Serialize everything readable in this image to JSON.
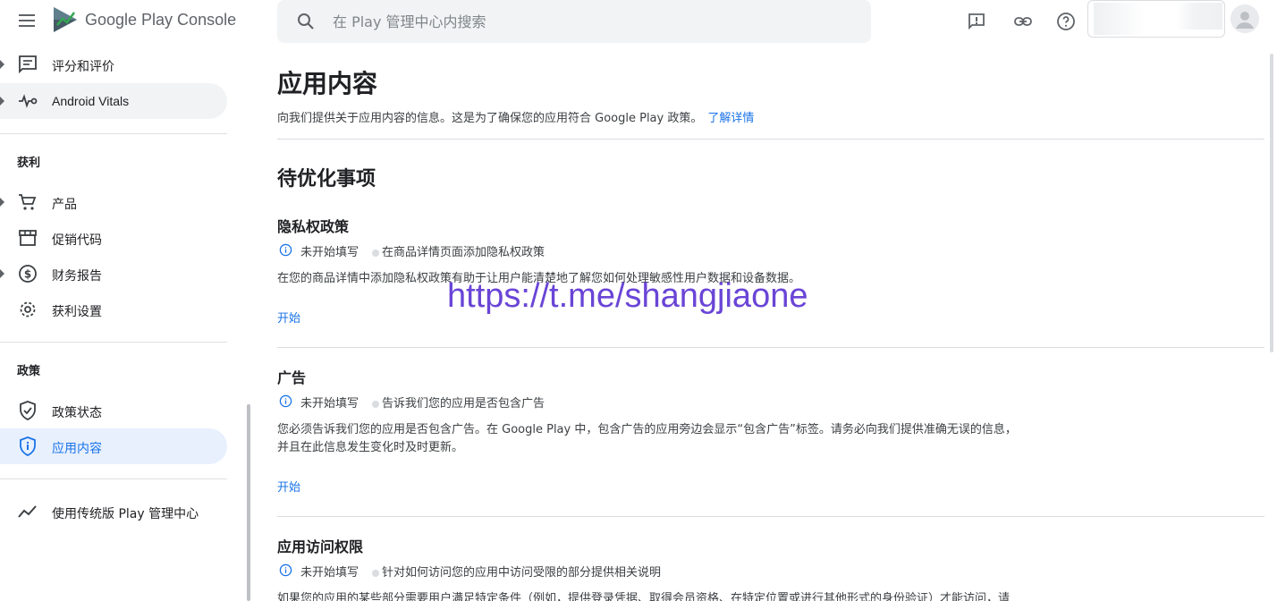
{
  "app": {
    "name": "Google Play Console"
  },
  "search": {
    "placeholder": "在 Play 管理中心内搜索"
  },
  "sidebar": {
    "items_top": [
      {
        "label": "评分和评价",
        "icon": "reviews-icon"
      },
      {
        "label": "Android Vitals",
        "icon": "vitals-icon"
      }
    ],
    "monetize_title": "获利",
    "monetize_items": [
      {
        "label": "产品",
        "icon": "cart-icon"
      },
      {
        "label": "促销代码",
        "icon": "store-icon"
      },
      {
        "label": "财务报告",
        "icon": "dollar-icon"
      },
      {
        "label": "获利设置",
        "icon": "gear-icon"
      }
    ],
    "policy_title": "政策",
    "policy_items": [
      {
        "label": "政策状态",
        "icon": "shield-check-icon"
      },
      {
        "label": "应用内容",
        "icon": "shield-info-icon"
      }
    ],
    "legacy": {
      "label": "使用传统版 Play 管理中心",
      "icon": "trending-icon"
    }
  },
  "main": {
    "title": "应用内容",
    "description": "向我们提供关于应用内容的信息。这是为了确保您的应用符合 Google Play 政策。",
    "learn_more": "了解详情",
    "todo_title": "待优化事项",
    "tasks": [
      {
        "title": "隐私权政策",
        "status": "未开始填写",
        "status_detail": "在商品详情页面添加隐私权政策",
        "desc_lines": [
          "在您的商品详情中添加隐私权政策有助于让用户能清楚地了解您如何处理敏感性用户数据和设备数据。"
        ],
        "action": "开始"
      },
      {
        "title": "广告",
        "status": "未开始填写",
        "status_detail": "告诉我们您的应用是否包含广告",
        "desc_lines": [
          "您必须告诉我们您的应用是否包含广告。在 Google Play 中，包含广告的应用旁边会显示“包含广告”标签。请务必向我们提供准确无误的信息，",
          "并且在此信息发生变化时及时更新。"
        ],
        "action": "开始"
      },
      {
        "title": "应用访问权限",
        "status": "未开始填写",
        "status_detail": "针对如何访问您的应用中访问受限的部分提供相关说明",
        "desc_lines": [
          "如果您的应用的某些部分需要用户满足特定条件（例如，提供登录凭据、取得会员资格、在特定位置或进行其他形式的身份验证）才能访问，请"
        ]
      }
    ]
  },
  "watermark": "https://t.me/shangjiaone",
  "colors": {
    "accent": "#1a73e8",
    "active_bg": "#e8f0fe",
    "watermark": "#6a45d6"
  }
}
